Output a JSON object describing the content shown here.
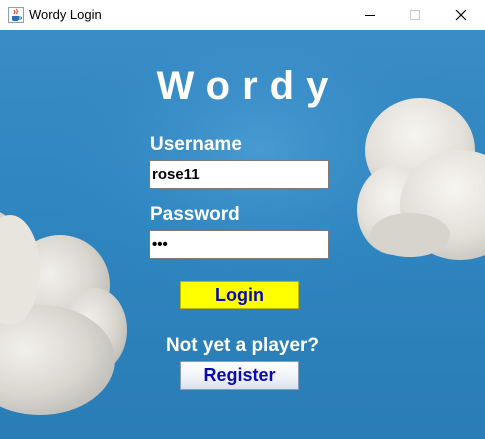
{
  "window": {
    "title": "Wordy Login",
    "app_icon": "java-cup-icon",
    "controls": {
      "minimize_icon": "minimize-icon",
      "maximize_icon": "maximize-icon",
      "close_icon": "close-icon"
    }
  },
  "login": {
    "heading": "Wordy",
    "username_label": "Username",
    "username_value": "rose11",
    "password_label": "Password",
    "password_value": "•••",
    "login_button": "Login",
    "register_prompt": "Not yet a player?",
    "register_button": "Register"
  },
  "colors": {
    "background": "#2f86c0",
    "login_button_bg": "#ffff00",
    "button_text": "#0a0ab4",
    "label_text": "#ffffff"
  }
}
